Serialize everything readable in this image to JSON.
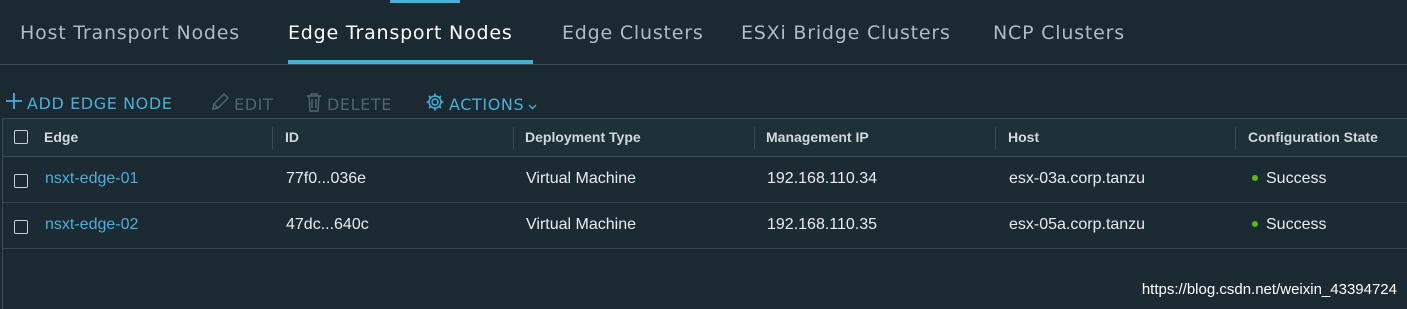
{
  "tabs": [
    {
      "label": "Host Transport Nodes"
    },
    {
      "label": "Edge Transport Nodes"
    },
    {
      "label": "Edge Clusters"
    },
    {
      "label": "ESXi Bridge Clusters"
    },
    {
      "label": "NCP Clusters"
    }
  ],
  "active_tab": "Edge Transport Nodes",
  "toolbar": {
    "add_label": "ADD EDGE NODE",
    "edit_label": "EDIT",
    "delete_label": "DELETE",
    "actions_label": "ACTIONS"
  },
  "table": {
    "columns": [
      "Edge",
      "ID",
      "Deployment Type",
      "Management IP",
      "Host",
      "Configuration State"
    ],
    "rows": [
      {
        "edge": "nsxt-edge-01",
        "id": "77f0...036e",
        "deployment_type": "Virtual Machine",
        "management_ip": "192.168.110.34",
        "host": "esx-03a.corp.tanzu",
        "state": "Success"
      },
      {
        "edge": "nsxt-edge-02",
        "id": "47dc...640c",
        "deployment_type": "Virtual Machine",
        "management_ip": "192.168.110.35",
        "host": "esx-05a.corp.tanzu",
        "state": "Success"
      }
    ]
  },
  "colors": {
    "accent": "#49afd9",
    "success": "#5eb715",
    "background": "#1b2a32"
  },
  "icons": {
    "add": "plus-icon",
    "edit": "pencil-icon",
    "delete": "trash-icon",
    "actions": "gear-icon",
    "actions_caret": "chevron-down-icon"
  },
  "watermark": "https://blog.csdn.net/weixin_43394724"
}
